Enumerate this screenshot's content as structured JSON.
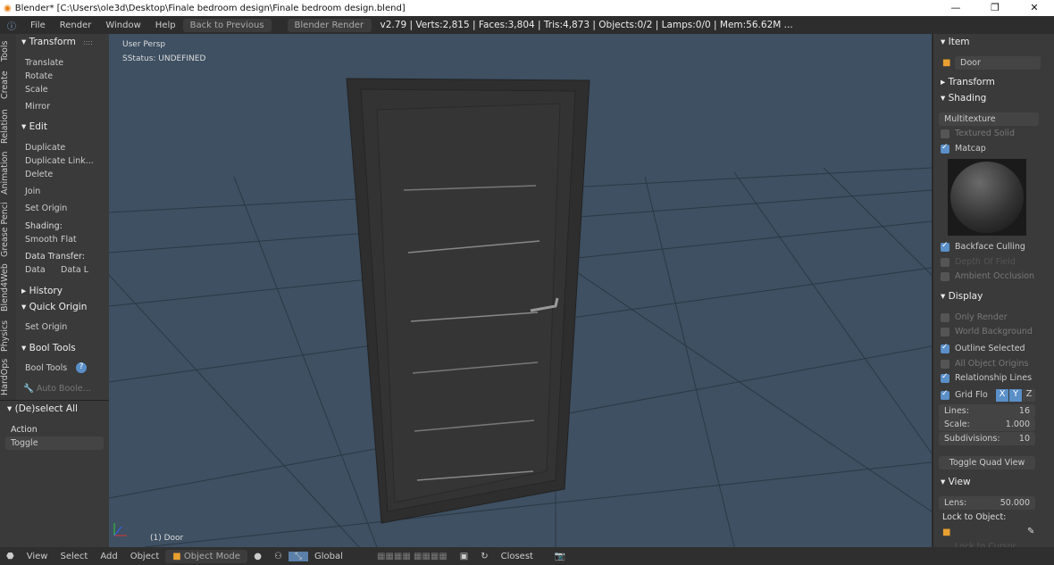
{
  "window": {
    "title": "Blender* [C:\\Users\\ole3d\\Desktop\\Finale bedroom design\\Finale bedroom design.blend]",
    "minimize": "—",
    "maximize": "❐",
    "close": "✕"
  },
  "menu": {
    "items": [
      "File",
      "Render",
      "Window",
      "Help"
    ],
    "back": "Back to Previous",
    "engine": "Blender Render",
    "stats": "v2.79 | Verts:2,815 | Faces:3,804 | Tris:4,873 | Objects:0/2 | Lamps:0/0 | Mem:56.62M ..."
  },
  "tabs": [
    "Tools",
    "Create",
    "Relation",
    "Animation",
    "Grease Penci",
    "Blend4Web",
    "Physics",
    "HardOps"
  ],
  "tools": {
    "transform": "Transform",
    "translate": "Translate",
    "rotate": "Rotate",
    "scale": "Scale",
    "mirror": "Mirror",
    "edit": "Edit",
    "duplicate": "Duplicate",
    "duplicate_linked": "Duplicate Link...",
    "delete": "Delete",
    "join": "Join",
    "set_origin": "Set Origin",
    "shading": "Shading:",
    "smooth": "Smooth",
    "flat": "Flat",
    "data_transfer": "Data Transfer:",
    "data": "Data",
    "data_l": "Data L",
    "history": "History",
    "quick_origin": "Quick Origin",
    "qo_set_origin": "Set Origin",
    "bool_tools": "Bool Tools",
    "bool_tools_item": "Bool Tools",
    "auto_boolean": "Auto Boole..."
  },
  "operator": {
    "title": "(De)select All",
    "action_label": "Action",
    "action_value": "Toggle"
  },
  "viewport": {
    "view_name": "User Persp",
    "status": "SStatus: UNDEFINED",
    "object_label": "(1) Door",
    "bg": "#3e5062"
  },
  "properties": {
    "item": "Item",
    "object_name": "Door",
    "transform": "Transform",
    "shading": "Shading",
    "shading_mode": "Multitexture",
    "textured_solid": "Textured Solid",
    "matcap": "Matcap",
    "backface_culling": "Backface Culling",
    "depth_of_field": "Depth Of Field",
    "ambient_occlusion": "Ambient Occlusion",
    "display": "Display",
    "only_render": "Only Render",
    "world_background": "World Background",
    "outline_selected": "Outline Selected",
    "all_object_origins": "All Object Origins",
    "relationship_lines": "Relationship Lines",
    "grid_floor": "Grid Flo",
    "axis_x": "X",
    "axis_y": "Y",
    "axis_z": "Z",
    "lines_label": "Lines:",
    "lines_value": "16",
    "scale_label": "Scale:",
    "scale_value": "1.000",
    "subdiv_label": "Subdivisions:",
    "subdiv_value": "10",
    "toggle_quad": "Toggle Quad View",
    "view": "View",
    "lens_label": "Lens:",
    "lens_value": "50.000",
    "lock_to_object": "Lock to Object:",
    "lock_to_cursor": "Lock to Cursor"
  },
  "bottom": {
    "items": [
      "View",
      "Select",
      "Add",
      "Object"
    ],
    "mode": "Object Mode",
    "orientation": "Global",
    "snap": "Closest"
  }
}
